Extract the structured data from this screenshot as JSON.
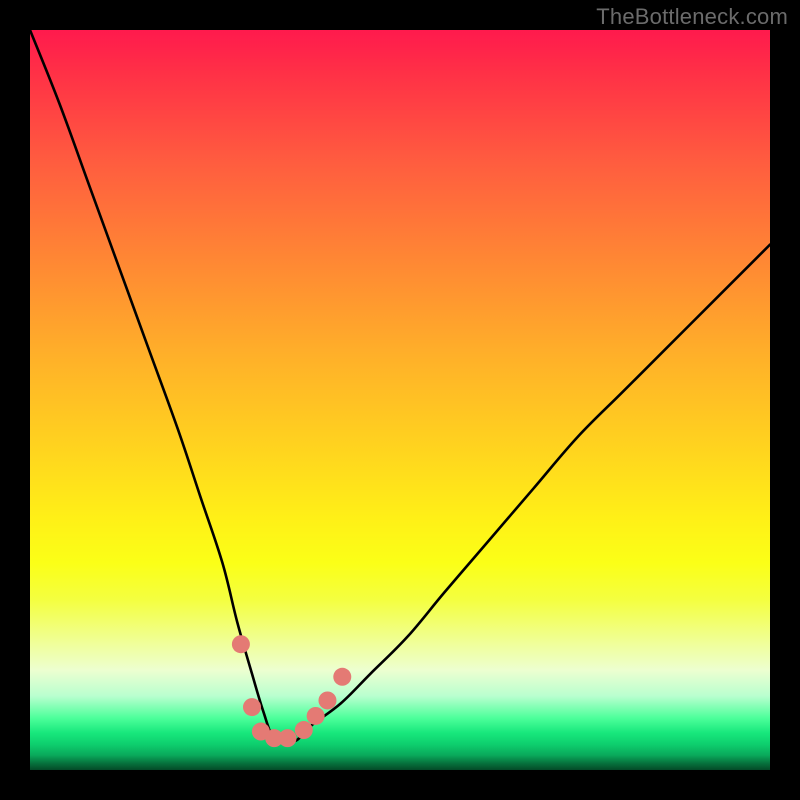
{
  "watermark": "TheBottleneck.com",
  "colors": {
    "gradient_top": "#ff1a4d",
    "gradient_mid": "#fff017",
    "gradient_bottom": "#044a27",
    "frame": "#000000",
    "curve": "#000000",
    "marker": "#e47a74"
  },
  "chart_data": {
    "type": "line",
    "title": "",
    "xlabel": "",
    "ylabel": "",
    "xlim": [
      0,
      100
    ],
    "ylim": [
      0,
      100
    ],
    "grid": false,
    "series": [
      {
        "name": "bottleneck-curve",
        "x": [
          0,
          4,
          8,
          12,
          16,
          20,
          23,
          26,
          28,
          30,
          31.5,
          33,
          34.5,
          36,
          38,
          42,
          46,
          51,
          56,
          62,
          68,
          74,
          80,
          86,
          92,
          98,
          100
        ],
        "y": [
          100,
          90,
          79,
          68,
          57,
          46,
          37,
          28,
          20,
          13,
          8,
          4,
          4,
          4,
          6,
          9,
          13,
          18,
          24,
          31,
          38,
          45,
          51,
          57,
          63,
          69,
          71
        ]
      }
    ],
    "markers": [
      {
        "x": 28.5,
        "y": 17
      },
      {
        "x": 30.0,
        "y": 8.5
      },
      {
        "x": 31.2,
        "y": 5.2
      },
      {
        "x": 33.0,
        "y": 4.3
      },
      {
        "x": 34.8,
        "y": 4.3
      },
      {
        "x": 37.0,
        "y": 5.4
      },
      {
        "x": 38.6,
        "y": 7.3
      },
      {
        "x": 40.2,
        "y": 9.4
      },
      {
        "x": 42.2,
        "y": 12.6
      }
    ],
    "marker_radius_px": 9
  }
}
